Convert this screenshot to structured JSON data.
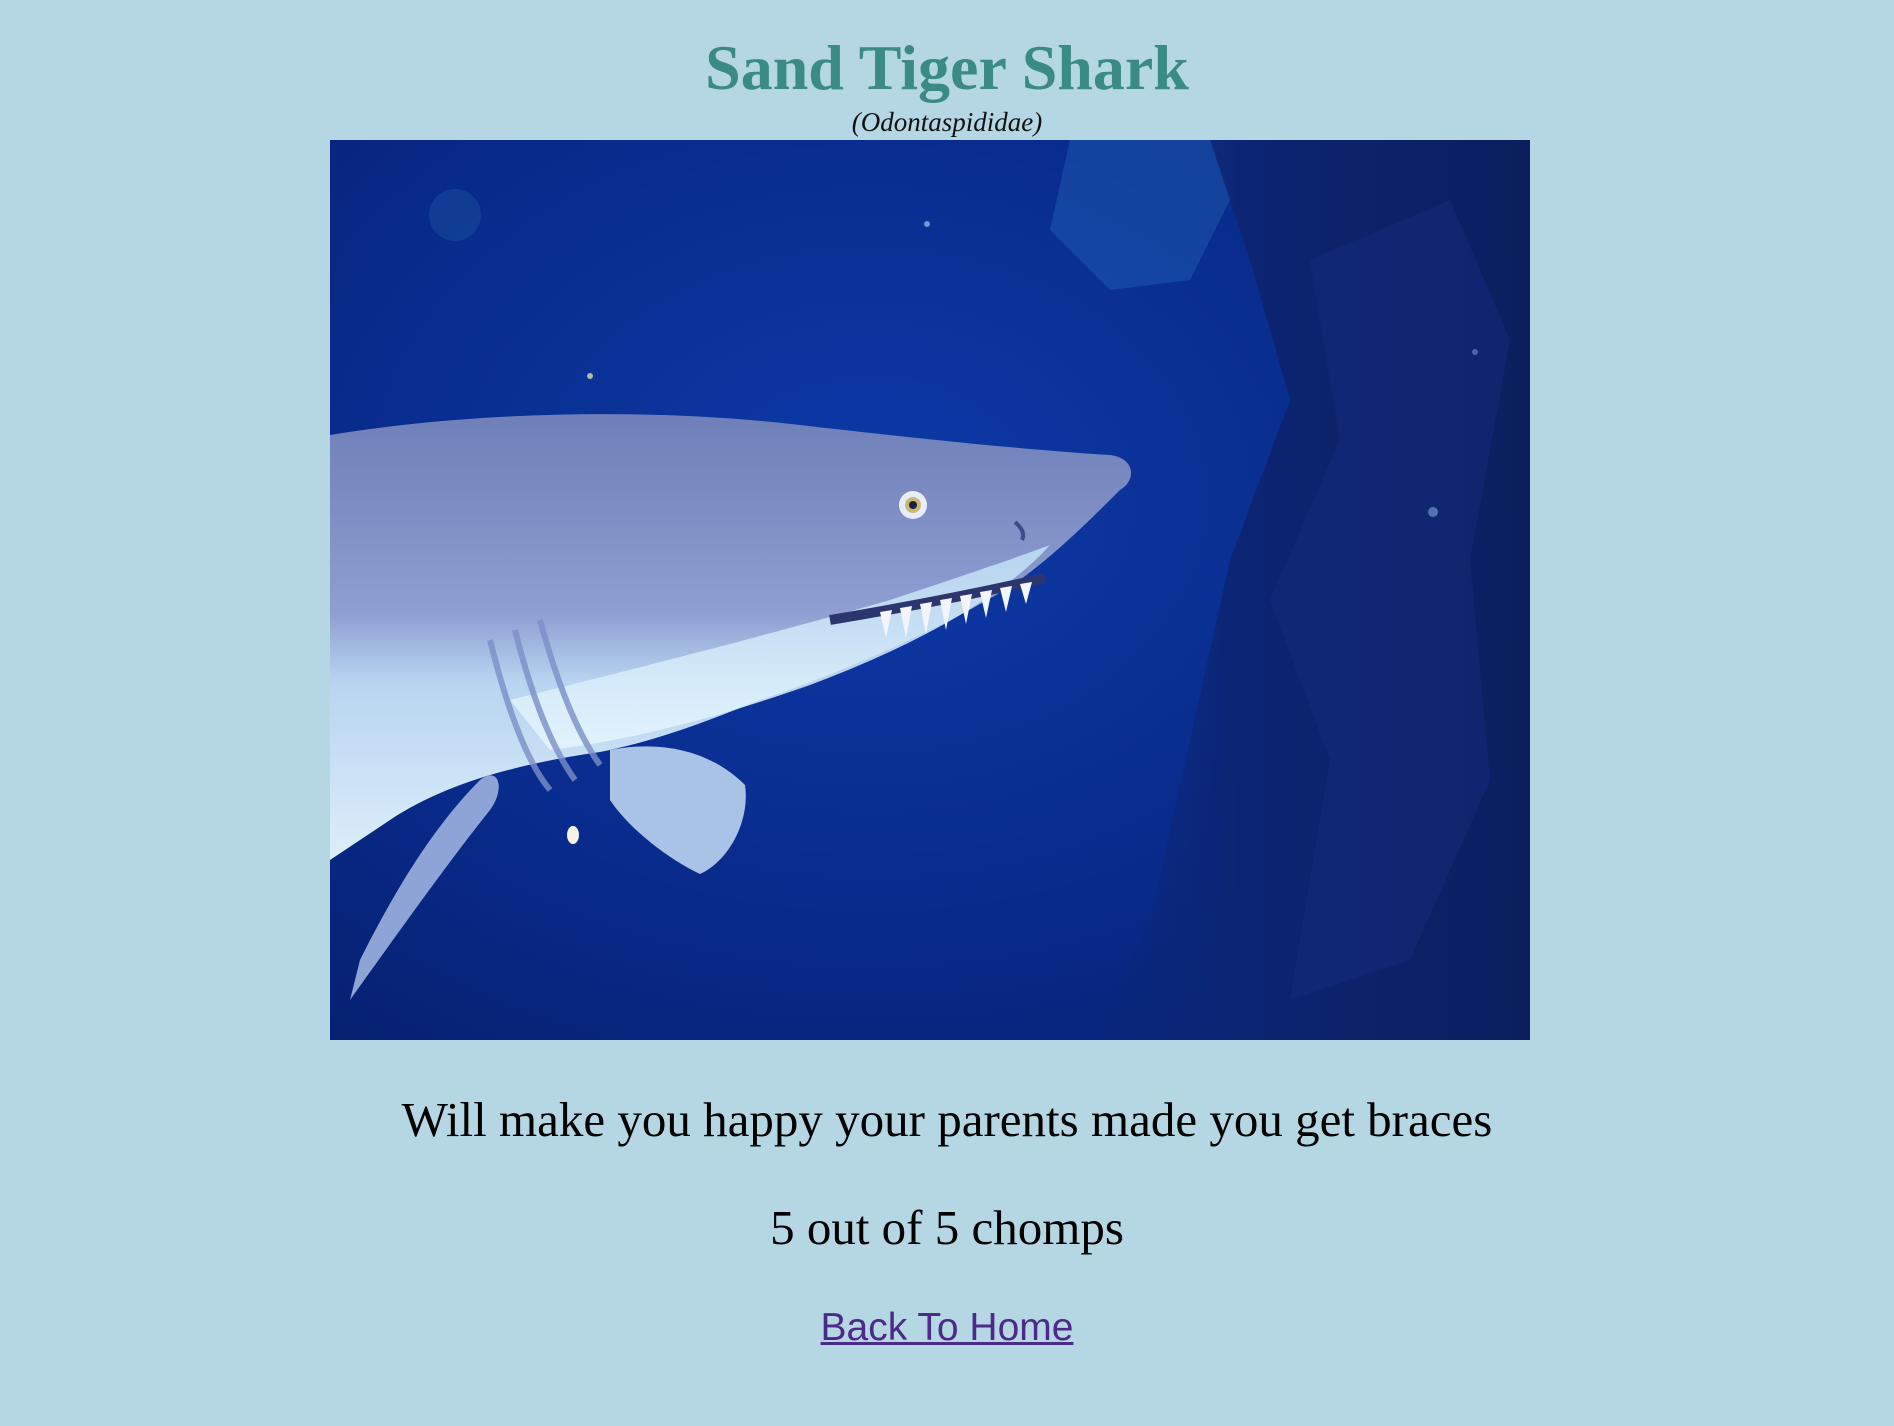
{
  "page": {
    "background_color": "#b5d7e3",
    "title_color": "#3a8a86",
    "link_color": "#4b2a8a"
  },
  "header": {
    "title": "Sand Tiger Shark",
    "scientific_name": "(Odontaspididae)"
  },
  "photo": {
    "subject": "sand-tiger-shark-photo"
  },
  "content": {
    "description": "Will make you happy your parents made you get braces",
    "rating": "5 out of 5 chomps"
  },
  "nav": {
    "back_home_label": "Back To Home"
  }
}
